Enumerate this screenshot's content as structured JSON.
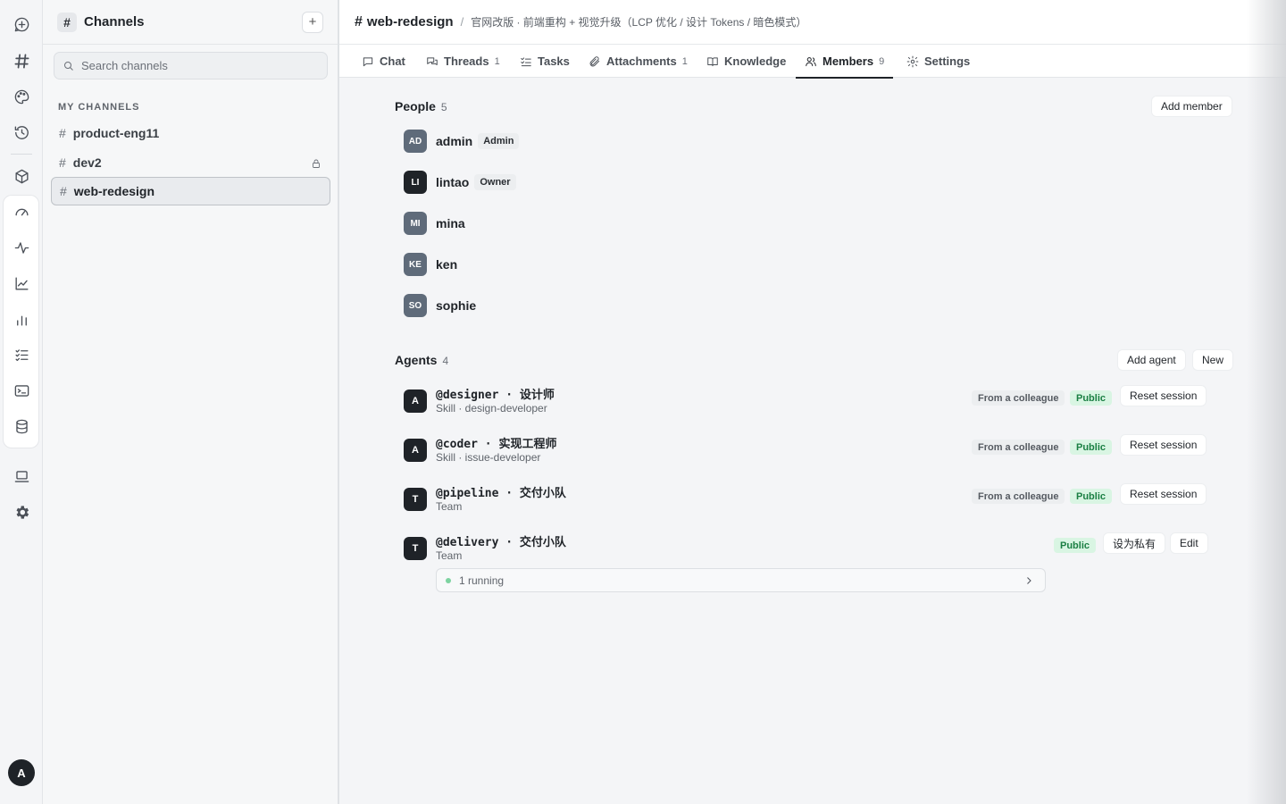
{
  "rail": {
    "items": [
      {
        "name": "new-chat-icon"
      },
      {
        "name": "channels-hash-icon"
      },
      {
        "name": "palette-icon"
      },
      {
        "name": "history-clock-icon"
      },
      {
        "name": "package-icon"
      },
      {
        "name": "dashboard-gauge-icon"
      },
      {
        "name": "activity-icon"
      },
      {
        "name": "line-chart-icon"
      },
      {
        "name": "bar-chart-icon"
      },
      {
        "name": "checklist-icon"
      },
      {
        "name": "terminal-icon"
      },
      {
        "name": "database-icon"
      },
      {
        "name": "laptop-icon"
      },
      {
        "name": "settings-gear-icon"
      }
    ],
    "avatar_initial": "A"
  },
  "sidebar": {
    "title": "Channels",
    "search_placeholder": "Search channels",
    "section_label": "MY CHANNELS",
    "channels": [
      {
        "name": "product-eng11",
        "locked": false,
        "active": false
      },
      {
        "name": "dev2",
        "locked": true,
        "active": false
      },
      {
        "name": "web-redesign",
        "locked": false,
        "active": true
      }
    ]
  },
  "header": {
    "hash": "#",
    "channel_name": "web-redesign",
    "slash": "/",
    "description": "官网改版 · 前端重构 + 视觉升级（LCP 优化 / 设计 Tokens / 暗色模式）"
  },
  "tabs": [
    {
      "label": "Chat",
      "count": ""
    },
    {
      "label": "Threads",
      "count": "1"
    },
    {
      "label": "Tasks",
      "count": ""
    },
    {
      "label": "Attachments",
      "count": "1"
    },
    {
      "label": "Knowledge",
      "count": ""
    },
    {
      "label": "Members",
      "count": "9",
      "active": true
    },
    {
      "label": "Settings",
      "count": ""
    }
  ],
  "people": {
    "title": "People",
    "count": "5",
    "add_label": "Add member",
    "members": [
      {
        "initials": "AD",
        "name": "admin",
        "role": "Admin"
      },
      {
        "initials": "LI",
        "name": "lintao",
        "role": "Owner"
      },
      {
        "initials": "MI",
        "name": "mina",
        "role": ""
      },
      {
        "initials": "KE",
        "name": "ken",
        "role": ""
      },
      {
        "initials": "SO",
        "name": "sophie",
        "role": ""
      }
    ]
  },
  "agents": {
    "title": "Agents",
    "count": "4",
    "add_label": "Add agent",
    "new_label": "New",
    "items": [
      {
        "initial": "A",
        "handle": "@designer · 设计师",
        "sub": "Skill · design-developer",
        "source": "From a colleague",
        "visibility": "Public",
        "action": "Reset session"
      },
      {
        "initial": "A",
        "handle": "@coder · 实现工程师",
        "sub": "Skill · issue-developer",
        "source": "From a colleague",
        "visibility": "Public",
        "action": "Reset session"
      },
      {
        "initial": "T",
        "handle": "@pipeline · 交付小队",
        "sub": "Team",
        "source": "From a colleague",
        "visibility": "Public",
        "action": "Reset session"
      },
      {
        "initial": "T",
        "handle": "@delivery · 交付小队",
        "sub": "Team",
        "visibility": "Public",
        "make_private": "设为私有",
        "edit": "Edit"
      }
    ],
    "running_label": "1 running"
  },
  "colors": {
    "accent": "#1f2328",
    "public_green": "#1a7f43",
    "public_bg": "#d9f5e3",
    "running_dot": "#7dd3a0"
  }
}
